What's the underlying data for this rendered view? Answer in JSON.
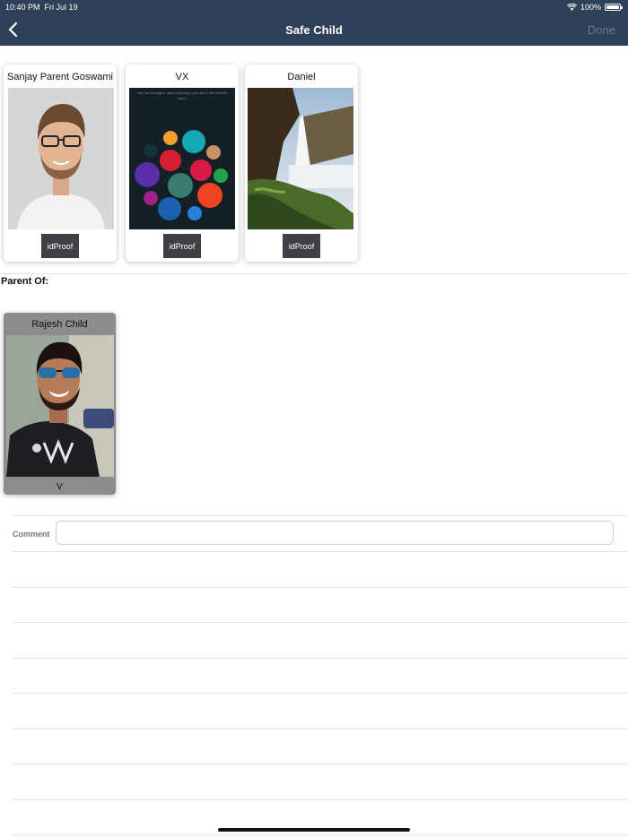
{
  "status_bar": {
    "time": "10:40 PM",
    "date": "Fri Jul 19",
    "battery": "100%"
  },
  "nav": {
    "title": "Safe Child",
    "done_label": "Done",
    "back_icon": "chevron-left-icon"
  },
  "parents": [
    {
      "name": "Sanjay Parent Goswami",
      "button": "idProof"
    },
    {
      "name": "VX",
      "button": "idProof",
      "photo_caption": "You can change it again whenever you like in the themes menu."
    },
    {
      "name": "Daniel",
      "button": "idProof"
    }
  ],
  "parent_of_label": "Parent Of:",
  "children": [
    {
      "name": "Rajesh Child",
      "subtitle": "V"
    }
  ],
  "comment": {
    "label": "Comment",
    "value": "",
    "placeholder": ""
  },
  "colors": {
    "nav_bg": "#2f4158",
    "button_bg": "#3e4046",
    "child_card_bg": "#8c8c8c",
    "done_disabled": "#6b7a8c"
  }
}
